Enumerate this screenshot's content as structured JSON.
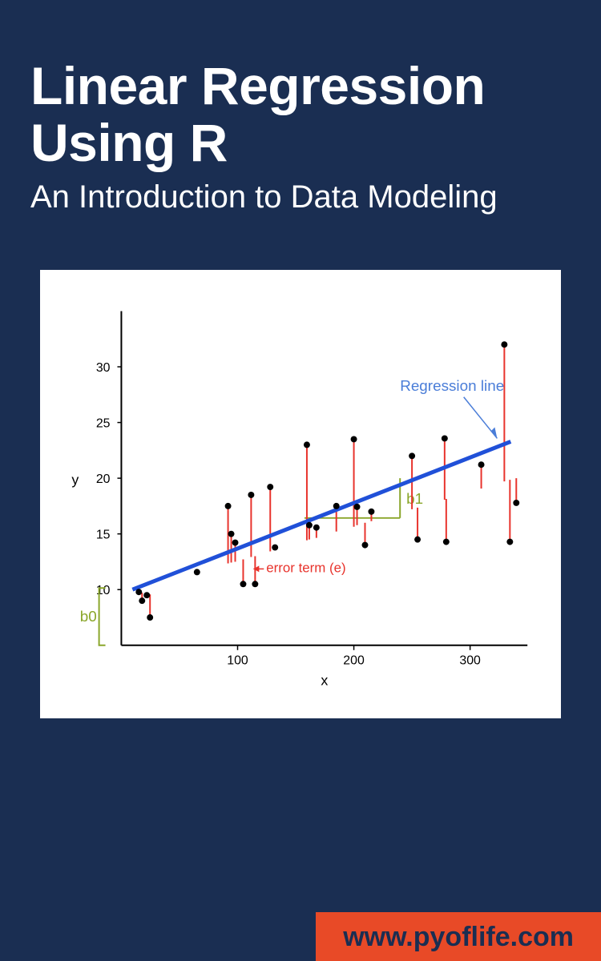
{
  "header": {
    "title": "Linear Regression Using R",
    "subtitle": "An Introduction to Data Modeling"
  },
  "footer": {
    "website": "www.pyoflife.com"
  },
  "chart_data": {
    "type": "scatter",
    "title": "",
    "xlabel": "x",
    "ylabel": "y",
    "xlim": [
      0,
      350
    ],
    "ylim": [
      5,
      35
    ],
    "xticks": [
      100,
      200,
      300
    ],
    "yticks": [
      10,
      15,
      20,
      25,
      30
    ],
    "regression_line": {
      "x": [
        10,
        335
      ],
      "y": [
        10,
        23.3
      ]
    },
    "points": [
      {
        "x": 15,
        "y": 9.8
      },
      {
        "x": 18,
        "y": 9.0
      },
      {
        "x": 22,
        "y": 9.5
      },
      {
        "x": 25,
        "y": 7.5
      },
      {
        "x": 65,
        "y": 11.6
      },
      {
        "x": 92,
        "y": 17.5
      },
      {
        "x": 95,
        "y": 15.0
      },
      {
        "x": 98,
        "y": 14.2
      },
      {
        "x": 105,
        "y": 10.5
      },
      {
        "x": 112,
        "y": 18.5
      },
      {
        "x": 115,
        "y": 10.5
      },
      {
        "x": 128,
        "y": 19.2
      },
      {
        "x": 132,
        "y": 13.8
      },
      {
        "x": 160,
        "y": 23.0
      },
      {
        "x": 162,
        "y": 15.8
      },
      {
        "x": 168,
        "y": 15.6
      },
      {
        "x": 185,
        "y": 17.5
      },
      {
        "x": 200,
        "y": 23.5
      },
      {
        "x": 203,
        "y": 17.4
      },
      {
        "x": 210,
        "y": 14.0
      },
      {
        "x": 215,
        "y": 17.0
      },
      {
        "x": 250,
        "y": 22.0
      },
      {
        "x": 255,
        "y": 14.5
      },
      {
        "x": 278,
        "y": 23.6
      },
      {
        "x": 280,
        "y": 14.3
      },
      {
        "x": 310,
        "y": 21.2
      },
      {
        "x": 330,
        "y": 32.0
      },
      {
        "x": 335,
        "y": 14.3
      },
      {
        "x": 340,
        "y": 17.8
      }
    ],
    "annotations": {
      "regression_label": "Regression line",
      "error_term_label": "error term (e)",
      "intercept_label": "b0",
      "slope_label": "b1"
    }
  }
}
